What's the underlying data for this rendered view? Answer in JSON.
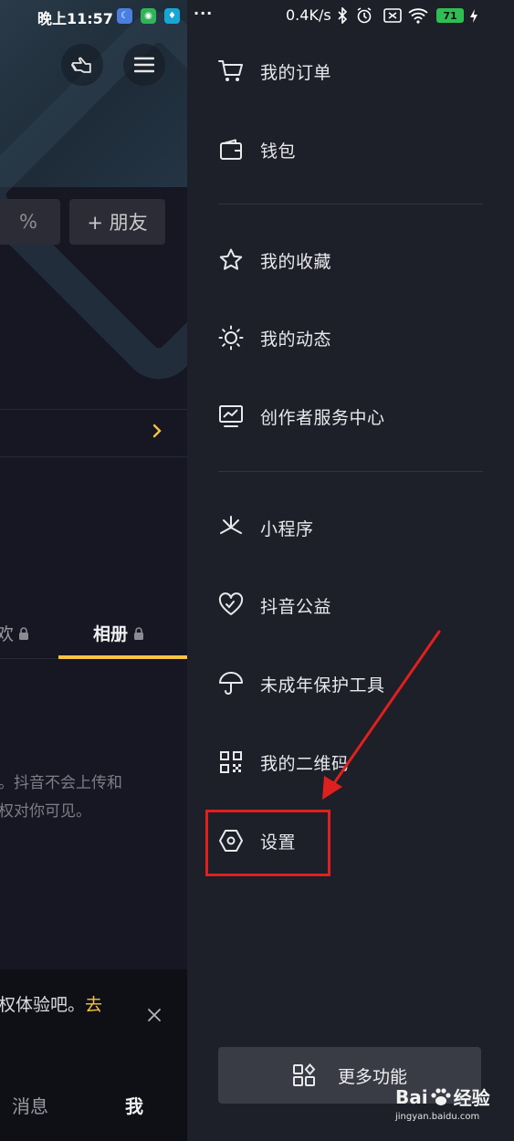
{
  "status_bar": {
    "time": "晚上11:57",
    "more": "···",
    "net_speed": "0.4K/s",
    "battery": "71"
  },
  "left_panel": {
    "percent_fragment": "%",
    "add_friend_label": "+ 朋友",
    "tab_fragment": "欢",
    "tab_album": "相册",
    "notice_line1": "。抖音不会上传和",
    "notice_line2": "权对你可见。",
    "banner_text": "权体验吧。",
    "banner_link": "去",
    "nav_messages": "消息",
    "nav_me": "我"
  },
  "drawer": {
    "groups": [
      [
        {
          "label": "我的订单",
          "icon": "cart-icon"
        },
        {
          "label": "钱包",
          "icon": "wallet-icon"
        }
      ],
      [
        {
          "label": "我的收藏",
          "icon": "star-icon"
        },
        {
          "label": "我的动态",
          "icon": "sun-icon"
        },
        {
          "label": "创作者服务中心",
          "icon": "chart-monitor-icon"
        }
      ],
      [
        {
          "label": "小程序",
          "icon": "mini-program-icon"
        },
        {
          "label": "抖音公益",
          "icon": "charity-heart-icon"
        },
        {
          "label": "未成年保护工具",
          "icon": "umbrella-icon"
        },
        {
          "label": "我的二维码",
          "icon": "qrcode-icon"
        },
        {
          "label": "设置",
          "icon": "settings-hex-icon"
        }
      ]
    ],
    "more_label": "更多功能"
  },
  "watermark": {
    "brand": "Bai",
    "brand2": "经验",
    "url": "jingyan.baidu.com"
  },
  "colors": {
    "accent_gold": "#f6c343",
    "highlight_red": "#e0201e",
    "drawer_bg": "#1d1f29"
  }
}
